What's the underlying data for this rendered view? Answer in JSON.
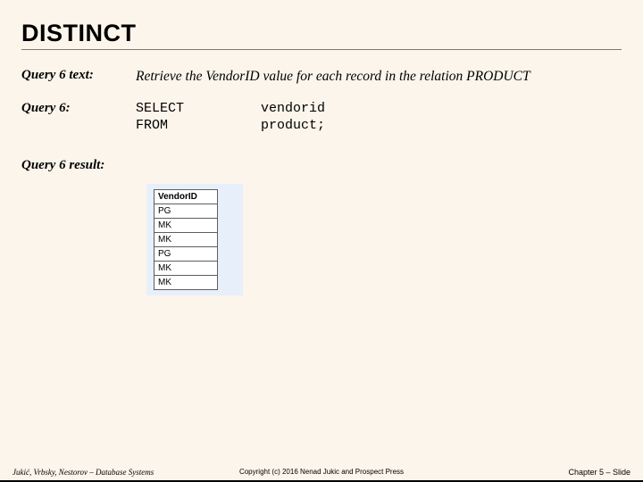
{
  "title": "DISTINCT",
  "query_text_label": "Query 6 text:",
  "query_text": "Retrieve the VendorID value for each record in the relation PRODUCT",
  "query_sql_label": "Query 6:",
  "sql": {
    "kw1": "SELECT",
    "val1": "vendorid",
    "kw2": "FROM",
    "val2": "product;"
  },
  "query_result_label": "Query 6 result:",
  "result_header": "VendorID",
  "result_rows": [
    "PG",
    "MK",
    "MK",
    "PG",
    "MK",
    "MK"
  ],
  "footer": {
    "left": "Jukić, Vrbsky, Nestorov – Database Systems",
    "center": "Copyright (c) 2016 Nenad Jukic and Prospect Press",
    "right": "Chapter 5 – Slide"
  }
}
